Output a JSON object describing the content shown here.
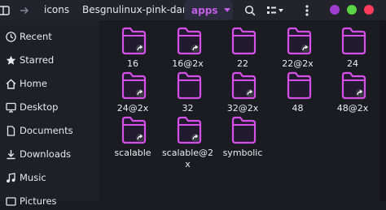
{
  "header": {
    "crumbs": [
      "icons",
      "Besgnulinux-pink-dark"
    ],
    "active_crumb": "apps"
  },
  "sidebar": {
    "items": [
      {
        "label": "Recent",
        "icon": "clock-icon"
      },
      {
        "label": "Starred",
        "icon": "star-icon"
      },
      {
        "label": "Home",
        "icon": "home-icon"
      },
      {
        "label": "Desktop",
        "icon": "desktop-icon"
      },
      {
        "label": "Documents",
        "icon": "document-icon"
      },
      {
        "label": "Downloads",
        "icon": "download-icon"
      },
      {
        "label": "Music",
        "icon": "music-icon"
      },
      {
        "label": "Pictures",
        "icon": "picture-icon"
      }
    ]
  },
  "files": [
    {
      "name": "16",
      "link": true
    },
    {
      "name": "16@2x",
      "link": true
    },
    {
      "name": "22",
      "link": false
    },
    {
      "name": "22@2x",
      "link": true
    },
    {
      "name": "24",
      "link": false
    },
    {
      "name": "24@2x",
      "link": true
    },
    {
      "name": "32",
      "link": false
    },
    {
      "name": "32@2x",
      "link": true
    },
    {
      "name": "48",
      "link": false
    },
    {
      "name": "48@2x",
      "link": true
    },
    {
      "name": "scalable",
      "link": true
    },
    {
      "name": "scalable@2x",
      "link": true
    },
    {
      "name": "symbolic",
      "link": false
    }
  ],
  "colors": {
    "accent": "#c45ee8",
    "folder_stroke": "#d64fe8",
    "folder_fill": "#221a2e"
  }
}
